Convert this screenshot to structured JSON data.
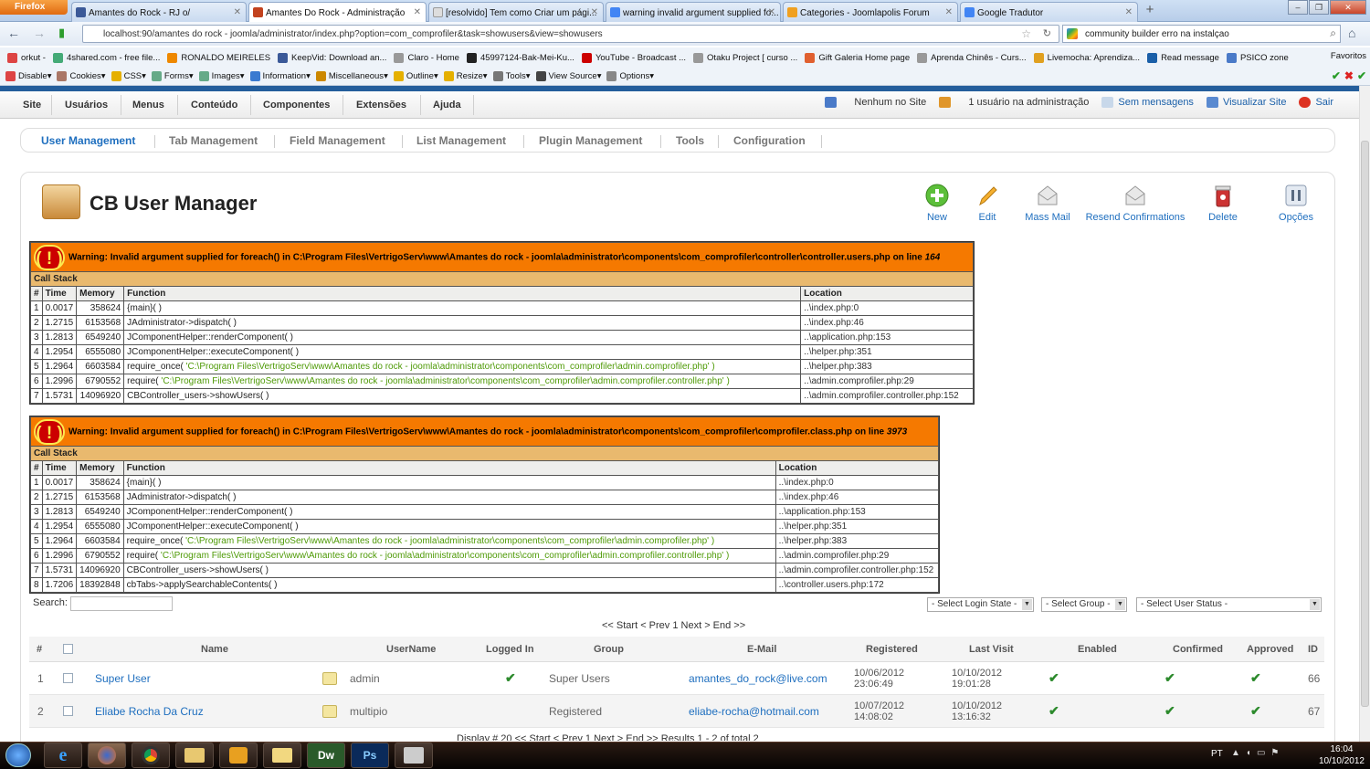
{
  "browser": {
    "menu_button": "Firefox",
    "tabs": [
      {
        "label": "Amantes do Rock - RJ o/",
        "color": "#3b5998"
      },
      {
        "label": "Amantes Do Rock - Administração",
        "color": "#c2421e"
      },
      {
        "label": "[resolvido] Tem como Criar um pági...",
        "color": "#999999"
      },
      {
        "label": "warning invalid argument supplied fo...",
        "color": "#4285f4"
      },
      {
        "label": "Categories - Joomlapolis Forum",
        "color": "#f0a020"
      },
      {
        "label": "Google Tradutor",
        "color": "#4285f4"
      }
    ],
    "new_tab": "+",
    "url": "localhost:90/amantes do rock - joomla/administrator/index.php?option=com_comprofiler&task=showusers&view=showusers",
    "search_value": "community builder erro na instalçao",
    "bookmarks": [
      "orkut -",
      "4shared.com - free file...",
      "RONALDO MEIRELES",
      "KeepVid: Download an...",
      "Claro - Home",
      "45997124-Bak-Mei-Ku...",
      "YouTube - Broadcast ...",
      "Otaku Project [ curso ...",
      "Gift Galeria Home page",
      "Aprenda Chinês - Curs...",
      "Livemocha: Aprendiza...",
      "Read message",
      "PSICO zone"
    ],
    "bookmarks_right": "Favoritos",
    "devbar": [
      "Disable",
      "Cookies",
      "CSS",
      "Forms",
      "Images",
      "Information",
      "Miscellaneous",
      "Outline",
      "Resize",
      "Tools",
      "View Source",
      "Options"
    ]
  },
  "admin_menu": {
    "items": [
      "Site",
      "Usuários",
      "Menus",
      "Conteúdo",
      "Componentes",
      "Extensões",
      "Ajuda"
    ],
    "status": {
      "site": "Nenhum no Site",
      "admin": "1 usuário na administração",
      "messages": "Sem mensagens",
      "view_site": "Visualizar Site",
      "logout": "Sair"
    }
  },
  "submenu": [
    "User Management",
    "Tab Management",
    "Field Management",
    "List Management",
    "Plugin Management",
    "Tools",
    "Configuration"
  ],
  "page": {
    "title": "CB User Manager",
    "toolbar": [
      "New",
      "Edit",
      "Mass Mail",
      "Resend Confirmations",
      "Delete",
      "Opções"
    ]
  },
  "warnings": [
    {
      "message": "Warning: Invalid argument supplied for foreach() in C:\\Program Files\\VertrigoServ\\www\\Amantes do rock - joomla\\administrator\\components\\com_comprofiler\\controller\\controller.users.php on line ",
      "line": "164",
      "call_stack": "Call Stack",
      "headers": [
        "#",
        "Time",
        "Memory",
        "Function",
        "Location"
      ],
      "rows": [
        [
          "1",
          "0.0017",
          "358624",
          "{main}( )",
          "",
          "..\\index.php:0"
        ],
        [
          "2",
          "1.2715",
          "6153568",
          "JAdministrator->dispatch( )",
          "",
          "..\\index.php:46"
        ],
        [
          "3",
          "1.2813",
          "6549240",
          "JComponentHelper::renderComponent( )",
          "",
          "..\\application.php:153"
        ],
        [
          "4",
          "1.2954",
          "6555080",
          "JComponentHelper::executeComponent( )",
          "",
          "..\\helper.php:351"
        ],
        [
          "5",
          "1.2964",
          "6603584",
          "require_once( ",
          "'C:\\Program Files\\VertrigoServ\\www\\Amantes do rock - joomla\\administrator\\components\\com_comprofiler\\admin.comprofiler.php' )",
          "..\\helper.php:383"
        ],
        [
          "6",
          "1.2996",
          "6790552",
          "require( ",
          "'C:\\Program Files\\VertrigoServ\\www\\Amantes do rock - joomla\\administrator\\components\\com_comprofiler\\admin.comprofiler.controller.php' )",
          "..\\admin.comprofiler.php:29"
        ],
        [
          "7",
          "1.5731",
          "14096920",
          "CBController_users->showUsers( )",
          "",
          "..\\admin.comprofiler.controller.php:152"
        ]
      ]
    },
    {
      "message": "Warning: Invalid argument supplied for foreach() in C:\\Program Files\\VertrigoServ\\www\\Amantes do rock - joomla\\administrator\\components\\com_comprofiler\\comprofiler.class.php on line ",
      "line": "3973",
      "call_stack": "Call Stack",
      "headers": [
        "#",
        "Time",
        "Memory",
        "Function",
        "Location"
      ],
      "rows": [
        [
          "1",
          "0.0017",
          "358624",
          "{main}( )",
          "",
          "..\\index.php:0"
        ],
        [
          "2",
          "1.2715",
          "6153568",
          "JAdministrator->dispatch( )",
          "",
          "..\\index.php:46"
        ],
        [
          "3",
          "1.2813",
          "6549240",
          "JComponentHelper::renderComponent( )",
          "",
          "..\\application.php:153"
        ],
        [
          "4",
          "1.2954",
          "6555080",
          "JComponentHelper::executeComponent( )",
          "",
          "..\\helper.php:351"
        ],
        [
          "5",
          "1.2964",
          "6603584",
          "require_once( ",
          "'C:\\Program Files\\VertrigoServ\\www\\Amantes do rock - joomla\\administrator\\components\\com_comprofiler\\admin.comprofiler.php' )",
          "..\\helper.php:383"
        ],
        [
          "6",
          "1.2996",
          "6790552",
          "require( ",
          "'C:\\Program Files\\VertrigoServ\\www\\Amantes do rock - joomla\\administrator\\components\\com_comprofiler\\admin.comprofiler.controller.php' )",
          "..\\admin.comprofiler.php:29"
        ],
        [
          "7",
          "1.5731",
          "14096920",
          "CBController_users->showUsers( )",
          "",
          "..\\admin.comprofiler.controller.php:152"
        ],
        [
          "8",
          "1.7206",
          "18392848",
          "cbTabs->applySearchableContents( )",
          "",
          "..\\controller.users.php:172"
        ]
      ]
    }
  ],
  "filters": {
    "search_label": "Search:",
    "login_state": "- Select Login State -",
    "group": "- Select Group -",
    "user_status": "- Select User Status -"
  },
  "pager": "<< Start < Prev 1 Next > End >>",
  "users_table": {
    "headers": [
      "#",
      "",
      "Name",
      "UserName",
      "Logged In",
      "Group",
      "E-Mail",
      "Registered",
      "Last Visit",
      "Enabled",
      "Confirmed",
      "Approved",
      "ID"
    ],
    "rows": [
      {
        "num": "1",
        "name": "Super User",
        "username": "admin",
        "logged_in": true,
        "group": "Super Users",
        "email": "amantes_do_rock@live.com",
        "registered_date": "10/06/2012",
        "registered_time": "23:06:49",
        "last_date": "10/10/2012",
        "last_time": "19:01:28",
        "enabled": true,
        "confirmed": true,
        "approved": true,
        "id": "66"
      },
      {
        "num": "2",
        "name": "Eliabe Rocha Da Cruz",
        "username": "multipio",
        "logged_in": false,
        "group": "Registered",
        "email": "eliabe-rocha@hotmail.com",
        "registered_date": "10/07/2012",
        "registered_time": "14:08:02",
        "last_date": "10/10/2012",
        "last_time": "13:16:32",
        "enabled": true,
        "confirmed": true,
        "approved": true,
        "id": "67"
      }
    ]
  },
  "footer": "Display # 20   << Start < Prev 1 Next > End >>   Results 1 - 2 of total 2",
  "taskbar": {
    "apps": [
      "ie",
      "firefox",
      "chrome",
      "explorer",
      "media",
      "folder",
      "Dw",
      "Ps",
      "video"
    ],
    "lang": "PT",
    "time": "16:04",
    "date": "10/10/2012"
  }
}
